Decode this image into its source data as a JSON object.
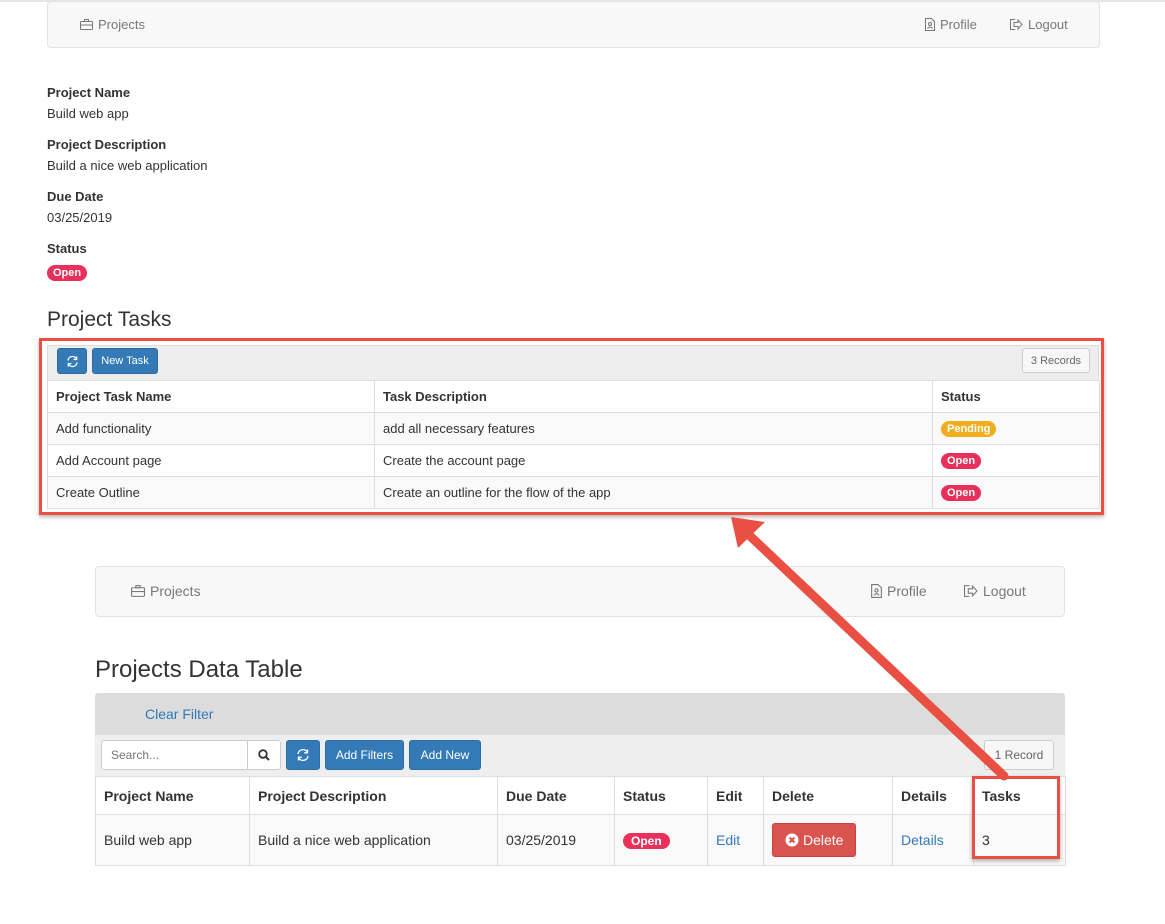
{
  "top_nav": {
    "projects": "Projects",
    "profile": "Profile",
    "logout": "Logout"
  },
  "project_details": {
    "name_label": "Project Name",
    "name": "Build web app",
    "description_label": "Project Description",
    "description": "Build a nice web application",
    "due_label": "Due Date",
    "due": "03/25/2019",
    "status_label": "Status",
    "status": "Open"
  },
  "tasks": {
    "title": "Project Tasks",
    "new_task": "New Task",
    "records": "3 Records",
    "columns": [
      "Project Task Name",
      "Task Description",
      "Status"
    ],
    "rows": [
      {
        "name": "Add functionality",
        "description": "add all necessary features",
        "status": "Pending"
      },
      {
        "name": "Add Account page",
        "description": "Create the account page",
        "status": "Open"
      },
      {
        "name": "Create Outline",
        "description": "Create an outline for the flow of the app",
        "status": "Open"
      }
    ]
  },
  "bottom_nav": {
    "projects": "Projects",
    "profile": "Profile",
    "logout": "Logout"
  },
  "projects_table": {
    "title": "Projects Data Table",
    "clear_filter": "Clear Filter",
    "search_placeholder": "Search...",
    "add_filters": "Add Filters",
    "add_new": "Add New",
    "records": "1 Record",
    "columns": [
      "Project Name",
      "Project Description",
      "Due Date",
      "Status",
      "Edit",
      "Delete",
      "Details",
      "Tasks"
    ],
    "row": {
      "name": "Build web app",
      "description": "Build a nice web application",
      "due": "03/25/2019",
      "status": "Open",
      "edit": "Edit",
      "delete": "Delete",
      "details": "Details",
      "tasks": "3"
    }
  },
  "colors": {
    "primary": "#337ab7",
    "danger": "#d9534f",
    "open": "#e8305a",
    "pending": "#f0ad1e",
    "annotation": "#ea4f43"
  },
  "icons": [
    "briefcase-icon",
    "profile-doc-icon",
    "logout-icon",
    "refresh-icon",
    "search-icon",
    "times-circle-icon"
  ]
}
